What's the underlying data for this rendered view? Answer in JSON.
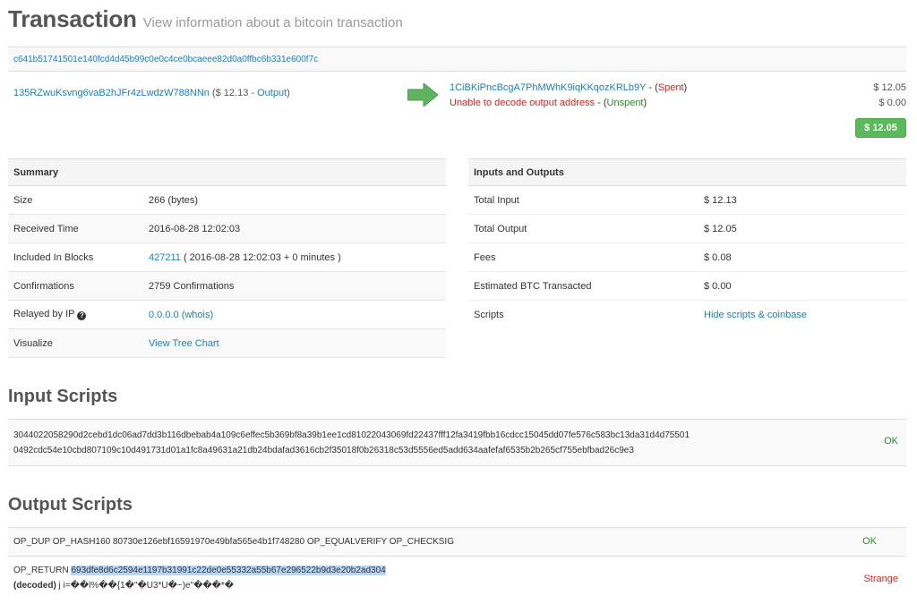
{
  "header": {
    "title": "Transaction",
    "subtitle": "View information about a bitcoin transaction"
  },
  "transaction": {
    "hash": "c641b51741501e140fcd4d45b99c0e0c4ce0bcaeee82d0a0ffbc6b331e600f7c",
    "input": {
      "address": "135RZwuKsvng6vaB2hJFr4zLwdzW788NNn",
      "amount_prefix": " ($ 12.13 - ",
      "type_link": "Output",
      "amount_suffix": ")"
    },
    "outputs": [
      {
        "address": "1CiBKiPncBcgA7PhMWhK9iqKKqozKRLb9Y",
        "separator": " - (",
        "status": "Spent",
        "close": ")",
        "amount": "$ 12.05"
      },
      {
        "address": "Unable to decode output address",
        "separator": " - (",
        "status": "Unspent",
        "close": ")",
        "amount": "$ 0.00"
      }
    ],
    "total_button": "$ 12.05"
  },
  "summary": {
    "heading": "Summary",
    "size_label": "Size",
    "size_value": "266 (bytes)",
    "received_label": "Received Time",
    "received_value": "2016-08-28 12:02:03",
    "blocks_label": "Included In Blocks",
    "block_link": "427211",
    "block_extra": " ( 2016-08-28 12:02:03 + 0 minutes )",
    "confirmations_label": "Confirmations",
    "confirmations_value": "2759 Confirmations",
    "relayed_label": "Relayed by IP",
    "relayed_help": "?",
    "relayed_value": "0.0.0.0 (whois)",
    "visualize_label": "Visualize",
    "visualize_link": "View Tree Chart"
  },
  "io": {
    "heading": "Inputs and Outputs",
    "total_input_label": "Total Input",
    "total_input_value": "$ 12.13",
    "total_output_label": "Total Output",
    "total_output_value": "$ 12.05",
    "fees_label": "Fees",
    "fees_value": "$ 0.08",
    "estimated_label": "Estimated BTC Transacted",
    "estimated_value": "$ 0.00",
    "scripts_label": "Scripts",
    "scripts_link": "Hide scripts & coinbase"
  },
  "input_scripts": {
    "heading": "Input Scripts",
    "line1": "3044022058290d2cebd1dc06ad7dd3b116dbebab4a109c6effec5b369bf8a39b1ee1cd81022043069fd22437fff12fa3419fbb16cdcc15045dd07fe576c583bc13da31d4d75501",
    "line2": "0492cdc54e10cbd807109c10d491731d01a1fc8a49631a21db24bdafad3616cb2f35018f0b26318c53d5556ed5add634aafefaf6535b2b265cf755ebfbad26c9e3",
    "status": "OK"
  },
  "output_scripts": {
    "heading": "Output Scripts",
    "row1_text": "OP_DUP OP_HASH160 80730e126ebf16591970e49bfa565e4b1f748280 OP_EQUALVERIFY OP_CHECKSIG",
    "row1_status": "OK",
    "row2_prefix": "OP_RETURN ",
    "row2_hex": "693dfe8d6c2594e1197b31991c22de0e55332a55b67e296522b9d3e20b2ad304",
    "row2_decoded_label": "(decoded)",
    "row2_decoded_value": " j i=��l%��{1�\"�U3*U�~)e\"���*�",
    "row2_status": "Strange"
  },
  "colors": {
    "link": "#1a7fc1",
    "spent": "#e02020",
    "unspent": "#2a8a2a",
    "button": "#5cb85c"
  }
}
